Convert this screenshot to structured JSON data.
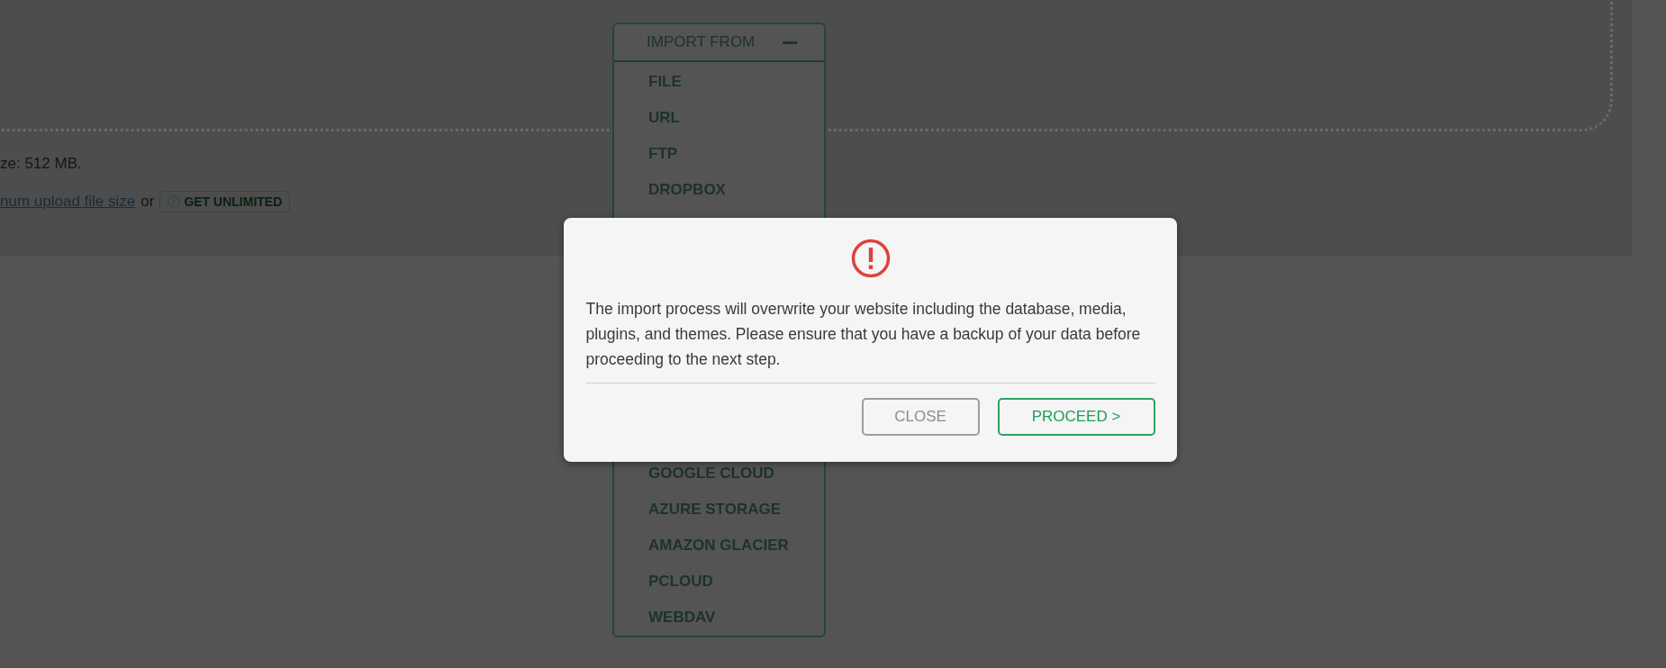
{
  "upload_panel": {
    "size_note": "ze: 512 MB.",
    "link": "num upload file size",
    "connector": "or",
    "unlimited_button": "GET UNLIMITED"
  },
  "import_menu": {
    "title": "IMPORT FROM",
    "expanded": true,
    "items_top": [
      "FILE",
      "URL",
      "FTP",
      "DROPBOX"
    ],
    "items_bottom": [
      "GOOGLE CLOUD",
      "AZURE STORAGE",
      "AMAZON GLACIER",
      "PCLOUD",
      "WEBDAV"
    ]
  },
  "dialog": {
    "message": "The import process will overwrite your website including the database, media, plugins, and themes. Please ensure that you have a backup of your data before proceeding to the next step.",
    "buttons": [
      {
        "label": "CLOSE",
        "kind": "secondary"
      },
      {
        "label": "PROCEED >",
        "kind": "primary"
      }
    ]
  }
}
